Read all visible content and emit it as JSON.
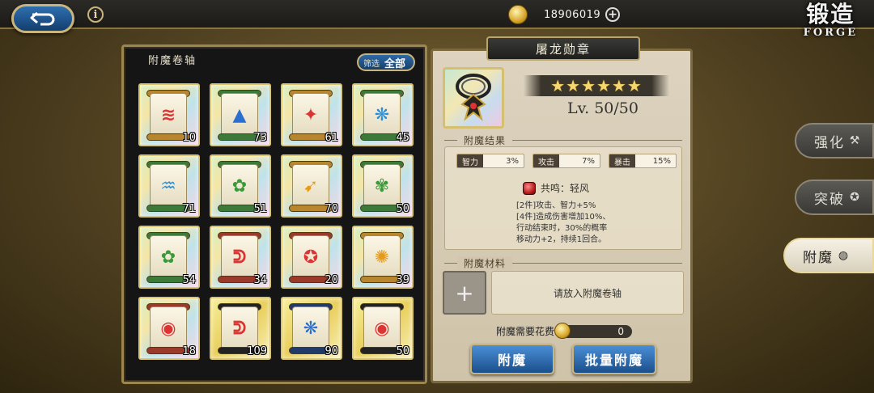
{
  "topbar": {
    "gold_amount": "18906019",
    "info_glyph": "i",
    "plus_glyph": "+"
  },
  "title": {
    "cn": "锻造",
    "en": "FORGE"
  },
  "left_panel": {
    "title": "附魔卷轴",
    "filter_label": "筛选",
    "filter_value": "全部",
    "scrolls": [
      {
        "count": "10",
        "roll": "#b8862e",
        "glyph": "≋",
        "color": "#d33"
      },
      {
        "count": "73",
        "roll": "#3d7a3a",
        "glyph": "▲",
        "color": "#2a6fd0"
      },
      {
        "count": "61",
        "roll": "#b8862e",
        "glyph": "✦",
        "color": "#d33"
      },
      {
        "count": "45",
        "roll": "#3d7a3a",
        "glyph": "❋",
        "color": "#2a8fd8"
      },
      {
        "count": "71",
        "roll": "#3d7a3a",
        "glyph": "♒",
        "color": "#2a8fd8"
      },
      {
        "count": "51",
        "roll": "#3d7a3a",
        "glyph": "✿",
        "color": "#3a9a3a"
      },
      {
        "count": "70",
        "roll": "#b8862e",
        "glyph": "➹",
        "color": "#e69a18"
      },
      {
        "count": "50",
        "roll": "#3d7a3a",
        "glyph": "✾",
        "color": "#3a9a3a"
      },
      {
        "count": "54",
        "roll": "#3d7a3a",
        "glyph": "✿",
        "color": "#3a9a3a"
      },
      {
        "count": "34",
        "roll": "#9a3a2a",
        "glyph": "ᕲ",
        "color": "#d33"
      },
      {
        "count": "20",
        "roll": "#9a3a2a",
        "glyph": "✪",
        "color": "#d33"
      },
      {
        "count": "39",
        "roll": "#b8862e",
        "glyph": "✺",
        "color": "#e69a18"
      },
      {
        "count": "18",
        "roll": "#9a3a2a",
        "glyph": "◉",
        "color": "#d33"
      },
      {
        "count": "109",
        "roll": "#222222",
        "glyph": "ᕲ",
        "color": "#d33",
        "gold": true
      },
      {
        "count": "90",
        "roll": "#223a6a",
        "glyph": "❋",
        "color": "#2a6fd0",
        "gold": true
      },
      {
        "count": "50",
        "roll": "#222222",
        "glyph": "◉",
        "color": "#d33",
        "gold": true
      }
    ]
  },
  "item": {
    "name": "屠龙勋章",
    "stars": "★★★★★★",
    "level": "Lv. 50/50",
    "result_title": "附魔结果",
    "stats": [
      {
        "name": "智力",
        "value": "3%"
      },
      {
        "name": "攻击",
        "value": "7%"
      },
      {
        "name": "暴击",
        "value": "15%"
      }
    ],
    "resonance": "共鸣：轻风",
    "res_lines": [
      "[2件]攻击、智力+5%",
      "[4件]造成伤害增加10%、",
      "行动结束时，30%的概率",
      "移动力+2，持续1回合。"
    ],
    "material_title": "附魔材料",
    "material_plus": "+",
    "material_hint": "请放入附魔卷轴",
    "cost_label": "附魔需要花费",
    "cost_value": "0",
    "btn_enchant": "附魔",
    "btn_batch": "批量附魔"
  },
  "side_tabs": [
    {
      "label": "强化",
      "icon": "hammer-icon",
      "glyph": "⚒"
    },
    {
      "label": "突破",
      "icon": "star-icon",
      "glyph": "✪"
    },
    {
      "label": "附魔",
      "icon": "enchant-icon",
      "glyph": "◍",
      "active": true
    }
  ],
  "colors": {
    "accent_blue": "#1a4f8c",
    "gold_border": "#c9b57c",
    "star_gold": "#f5d76e"
  }
}
